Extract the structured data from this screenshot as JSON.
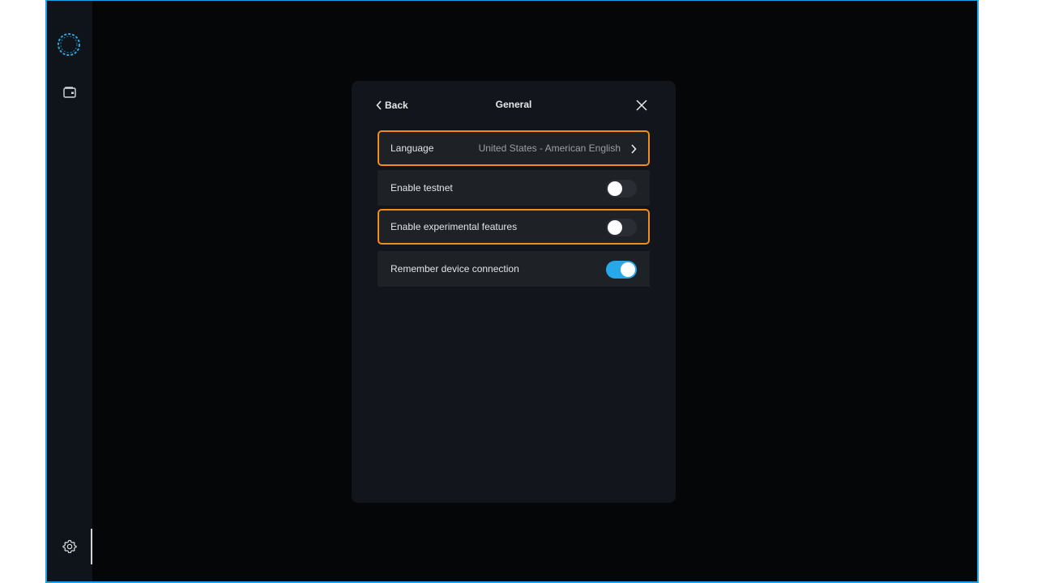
{
  "panel": {
    "back_label": "Back",
    "title": "General"
  },
  "settings": [
    {
      "label": "Language",
      "value": "United States - American English",
      "type": "link"
    },
    {
      "label": "Enable testnet",
      "type": "toggle",
      "on": false
    },
    {
      "label": "Enable experimental features",
      "type": "toggle",
      "on": false
    },
    {
      "label": "Remember device connection",
      "type": "toggle",
      "on": true
    }
  ],
  "icons": {
    "logo": "dashed-circle-logo-icon",
    "wallet": "wallet-icon",
    "settings": "gear-icon",
    "back": "chevron-left-icon",
    "close": "close-icon",
    "language_arrow": "chevron-right-icon"
  },
  "colors": {
    "accent": "#26a8eb",
    "highlight": "#f28c1a",
    "panel_bg": "#12161c",
    "row_bg": "#1e2126"
  }
}
